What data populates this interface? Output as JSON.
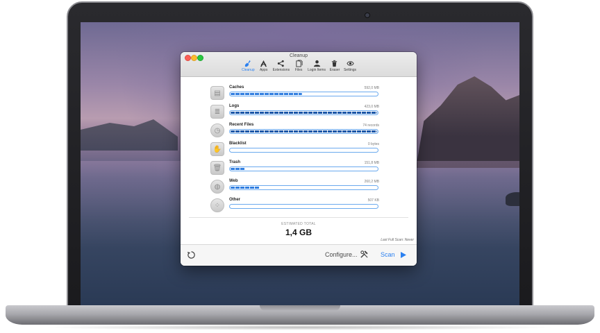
{
  "window": {
    "title": "Cleanup"
  },
  "toolbar": {
    "items": [
      {
        "label": "Cleanup",
        "icon": "broom-icon",
        "active": true
      },
      {
        "label": "Apps",
        "icon": "apps-icon",
        "active": false
      },
      {
        "label": "Extensions",
        "icon": "share-icon",
        "active": false
      },
      {
        "label": "Files",
        "icon": "files-icon",
        "active": false
      },
      {
        "label": "Login Items",
        "icon": "person-icon",
        "active": false
      },
      {
        "label": "Eraser",
        "icon": "trash-icon",
        "active": false
      },
      {
        "label": "Settings",
        "icon": "eye-icon",
        "active": false
      }
    ]
  },
  "cleanup": {
    "items": [
      {
        "name": "Caches",
        "size": "592,0 MB",
        "fill": 0.49,
        "icon": "cache-icon"
      },
      {
        "name": "Logs",
        "size": "423,0 MB",
        "fill": 1.0,
        "icon": "logs-icon"
      },
      {
        "name": "Recent Files",
        "size": "74 records",
        "fill": 1.0,
        "icon": "clock-icon"
      },
      {
        "name": "Blacklist",
        "size": "0 bytes",
        "fill": 0.0,
        "icon": "blacklist-icon"
      },
      {
        "name": "Trash",
        "size": "151,8 MB",
        "fill": 0.1,
        "icon": "trash-icon"
      },
      {
        "name": "Web",
        "size": "260,2 MB",
        "fill": 0.2,
        "icon": "globe-icon"
      },
      {
        "name": "Other",
        "size": "507 KB",
        "fill": 0.0,
        "icon": "other-icon"
      }
    ]
  },
  "summary": {
    "label": "ESTIMATED TOTAL",
    "value": "1,4 GB",
    "last_scan": "Last Full Scan: Never"
  },
  "footer": {
    "configure_label": "Configure...",
    "scan_label": "Scan"
  },
  "colors": {
    "accent": "#2b80f0",
    "bar_fill": "#2f7de0",
    "bar_fill_full": "#1a56a8",
    "close": "#fc5f57",
    "minimize": "#fdbc2e",
    "maximize": "#29c840"
  }
}
